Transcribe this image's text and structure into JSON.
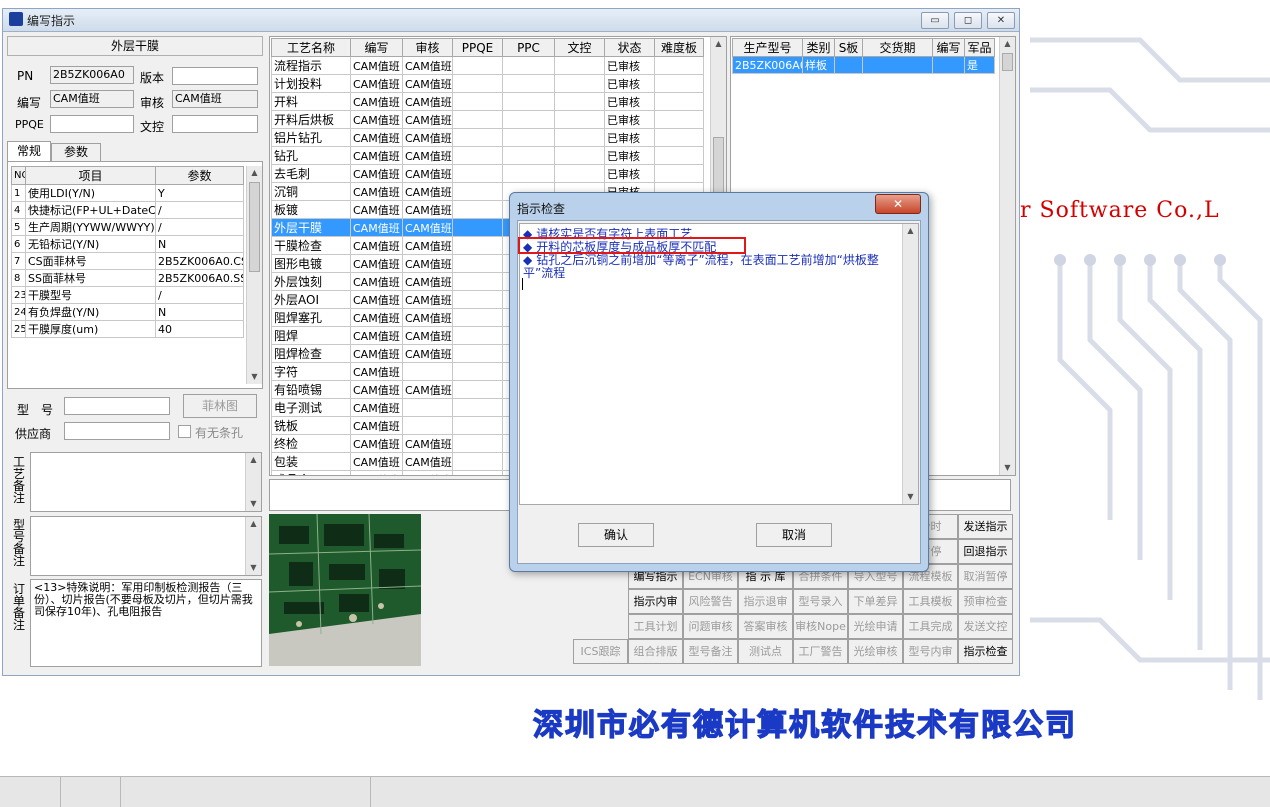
{
  "window": {
    "title": "编写指示",
    "minimize": "▭",
    "maximize": "◻",
    "close": "✕"
  },
  "left": {
    "header": "外层干膜",
    "pn_label": "PN",
    "pn_value": "2B5ZK006A0",
    "version_label": "版本",
    "version_value": "",
    "author_label": "编写",
    "author_value": "CAM值班",
    "review_label": "审核",
    "review_value": "CAM值班",
    "ppqe_label": "PPQE",
    "ppqe_value": "",
    "wenkong_label": "文控",
    "wenkong_value": "",
    "tabs": [
      "常规",
      "参数"
    ],
    "param_headers": [
      "NO",
      "项目",
      "参数"
    ],
    "params": [
      {
        "no": "1",
        "item": "使用LDI(Y/N)",
        "value": "Y"
      },
      {
        "no": "4",
        "item": "快捷标记(FP+UL+DateC",
        "value": "/"
      },
      {
        "no": "5",
        "item": "生产周期(YYWW/WWYY)",
        "value": "/"
      },
      {
        "no": "6",
        "item": "无铅标记(Y/N)",
        "value": "N"
      },
      {
        "no": "7",
        "item": "CS面菲林号",
        "value": "2B5ZK006A0.CS"
      },
      {
        "no": "8",
        "item": "SS面菲林号",
        "value": "2B5ZK006A0.SS"
      },
      {
        "no": "23",
        "item": "干膜型号",
        "value": "/"
      },
      {
        "no": "24",
        "item": "有负焊盘(Y/N)",
        "value": "N"
      },
      {
        "no": "25",
        "item": "干膜厚度(um)",
        "value": "40"
      }
    ],
    "model_label": "型　号",
    "film_button": "菲林图",
    "supplier_label": "供应商",
    "no_strip_label": "有无条孔",
    "process_note_label": "工艺备注",
    "model_note_label": "型号备注",
    "order_note_label": "订单备注",
    "order_note_text": "<13>特殊说明：军用印制板检测报告（三份）、切片报告(不要母板及切片，但切片需我司保存10年)、孔电阻报告"
  },
  "process": {
    "headers": [
      "工艺名称",
      "编写",
      "审核",
      "PPQE",
      "PPC",
      "文控",
      "状态",
      "难度板"
    ],
    "rows": [
      {
        "name": "流程指示",
        "author": "CAM值班",
        "review": "CAM值班",
        "status": "已审核"
      },
      {
        "name": "计划投料",
        "author": "CAM值班",
        "review": "CAM值班",
        "status": "已审核"
      },
      {
        "name": "开料",
        "author": "CAM值班",
        "review": "CAM值班",
        "status": "已审核"
      },
      {
        "name": "开料后烘板",
        "author": "CAM值班",
        "review": "CAM值班",
        "status": "已审核"
      },
      {
        "name": "铝片钻孔",
        "author": "CAM值班",
        "review": "CAM值班",
        "status": "已审核"
      },
      {
        "name": "钻孔",
        "author": "CAM值班",
        "review": "CAM值班",
        "status": "已审核"
      },
      {
        "name": "去毛刺",
        "author": "CAM值班",
        "review": "CAM值班",
        "status": "已审核"
      },
      {
        "name": "沉铜",
        "author": "CAM值班",
        "review": "CAM值班",
        "status": "已审核"
      },
      {
        "name": "板镀",
        "author": "CAM值班",
        "review": "CAM值班",
        "status": ""
      },
      {
        "name": "外层干膜",
        "author": "CAM值班",
        "review": "CAM值班",
        "status": ""
      },
      {
        "name": "干膜检查",
        "author": "CAM值班",
        "review": "CAM值班",
        "status": ""
      },
      {
        "name": "图形电镀",
        "author": "CAM值班",
        "review": "CAM值班",
        "status": ""
      },
      {
        "name": "外层蚀刻",
        "author": "CAM值班",
        "review": "CAM值班",
        "status": ""
      },
      {
        "name": "外层AOI",
        "author": "CAM值班",
        "review": "CAM值班",
        "status": ""
      },
      {
        "name": "阻焊塞孔",
        "author": "CAM值班",
        "review": "CAM值班",
        "status": ""
      },
      {
        "name": "阻焊",
        "author": "CAM值班",
        "review": "CAM值班",
        "status": ""
      },
      {
        "name": "阻焊检查",
        "author": "CAM值班",
        "review": "CAM值班",
        "status": ""
      },
      {
        "name": "字符",
        "author": "CAM值班",
        "review": "",
        "status": ""
      },
      {
        "name": "有铅喷锡",
        "author": "CAM值班",
        "review": "CAM值班",
        "status": ""
      },
      {
        "name": "电子测试",
        "author": "CAM值班",
        "review": "",
        "status": ""
      },
      {
        "name": "铣板",
        "author": "CAM值班",
        "review": "",
        "status": ""
      },
      {
        "name": "终检",
        "author": "CAM值班",
        "review": "CAM值班",
        "status": ""
      },
      {
        "name": "包装",
        "author": "CAM值班",
        "review": "CAM值班",
        "status": ""
      },
      {
        "name": "成品仓",
        "author": "CAM值班",
        "review": "CAM值班",
        "status": ""
      }
    ],
    "selected_index": 9
  },
  "orders": {
    "headers": [
      "生产型号",
      "类别",
      "S板",
      "交货期",
      "编写",
      "军品"
    ],
    "rows": [
      {
        "model": "2B5ZK006A0",
        "type": "样板",
        "s": "",
        "date": "",
        "author": "",
        "military": "是"
      }
    ]
  },
  "buttons": [
    [
      "",
      "",
      "",
      "",
      "",
      "计时",
      "发送指示"
    ],
    [
      "",
      "",
      "",
      "",
      "",
      "暂停",
      "回退指示"
    ],
    [
      "编写指示",
      "ECN审核",
      "指 示 库",
      "合拼条件",
      "导入型号",
      "流程模板",
      "取消暂停"
    ],
    [
      "指示内审",
      "风险警告",
      "指示退审",
      "型号录入",
      "下单差异",
      "工具模板",
      "预审检查"
    ],
    [
      "工具计划",
      "问题审核",
      "答案审核",
      "审核Nope",
      "光绘申请",
      "工具完成",
      "发送文控"
    ],
    [
      "ICS跟踪",
      "组合排版",
      "型号备注",
      "测试点",
      "工厂警告",
      "光绘审核",
      "型号内审",
      "指示检查"
    ]
  ],
  "dialog": {
    "title": "指示检查",
    "close": "✕",
    "messages": [
      "请核实是否有字符上表面工艺",
      "开料的芯板厚度与成品板厚不匹配",
      "钻孔之后沉铜之前增加“等离子”流程，在表面工艺前增加“烘板整",
      "平”流程"
    ],
    "ok": "确认",
    "cancel": "取消"
  },
  "background": {
    "software_text": "r Software Co.,L",
    "company_text": "深圳市必有德计算机软件技术有限公司"
  }
}
